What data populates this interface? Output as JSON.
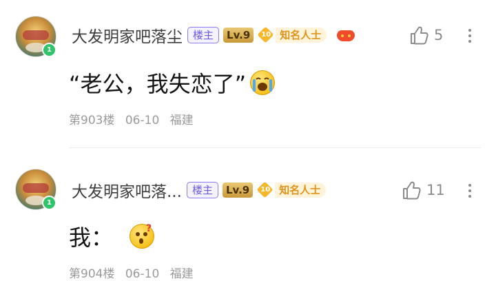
{
  "posts": [
    {
      "username": "大发明家吧落尘",
      "badge_louzhu": "楼主",
      "badge_level": "Lv.9",
      "fame_level": "10",
      "fame_title": "知名人士",
      "has_extra_icon": true,
      "like_count": "5",
      "content_text": "“老公，我失恋了”",
      "content_emoji": "crying-face-emoji",
      "floor": "第903楼",
      "date": "06-10",
      "location": "福建"
    },
    {
      "username": "大发明家吧落...",
      "badge_louzhu": "楼主",
      "badge_level": "Lv.9",
      "fame_level": "10",
      "fame_title": "知名人士",
      "has_extra_icon": false,
      "like_count": "11",
      "content_text": "我：",
      "content_emoji": "surprised-face-emoji",
      "floor": "第904楼",
      "date": "06-10",
      "location": "福建"
    }
  ],
  "colors": {
    "louzhu_badge": "#6a5ae8",
    "level_badge": "#c9993a",
    "fame_badge": "#f6b82a",
    "meta_text": "#9a9a9a",
    "level_dot": "#2fc46a"
  }
}
